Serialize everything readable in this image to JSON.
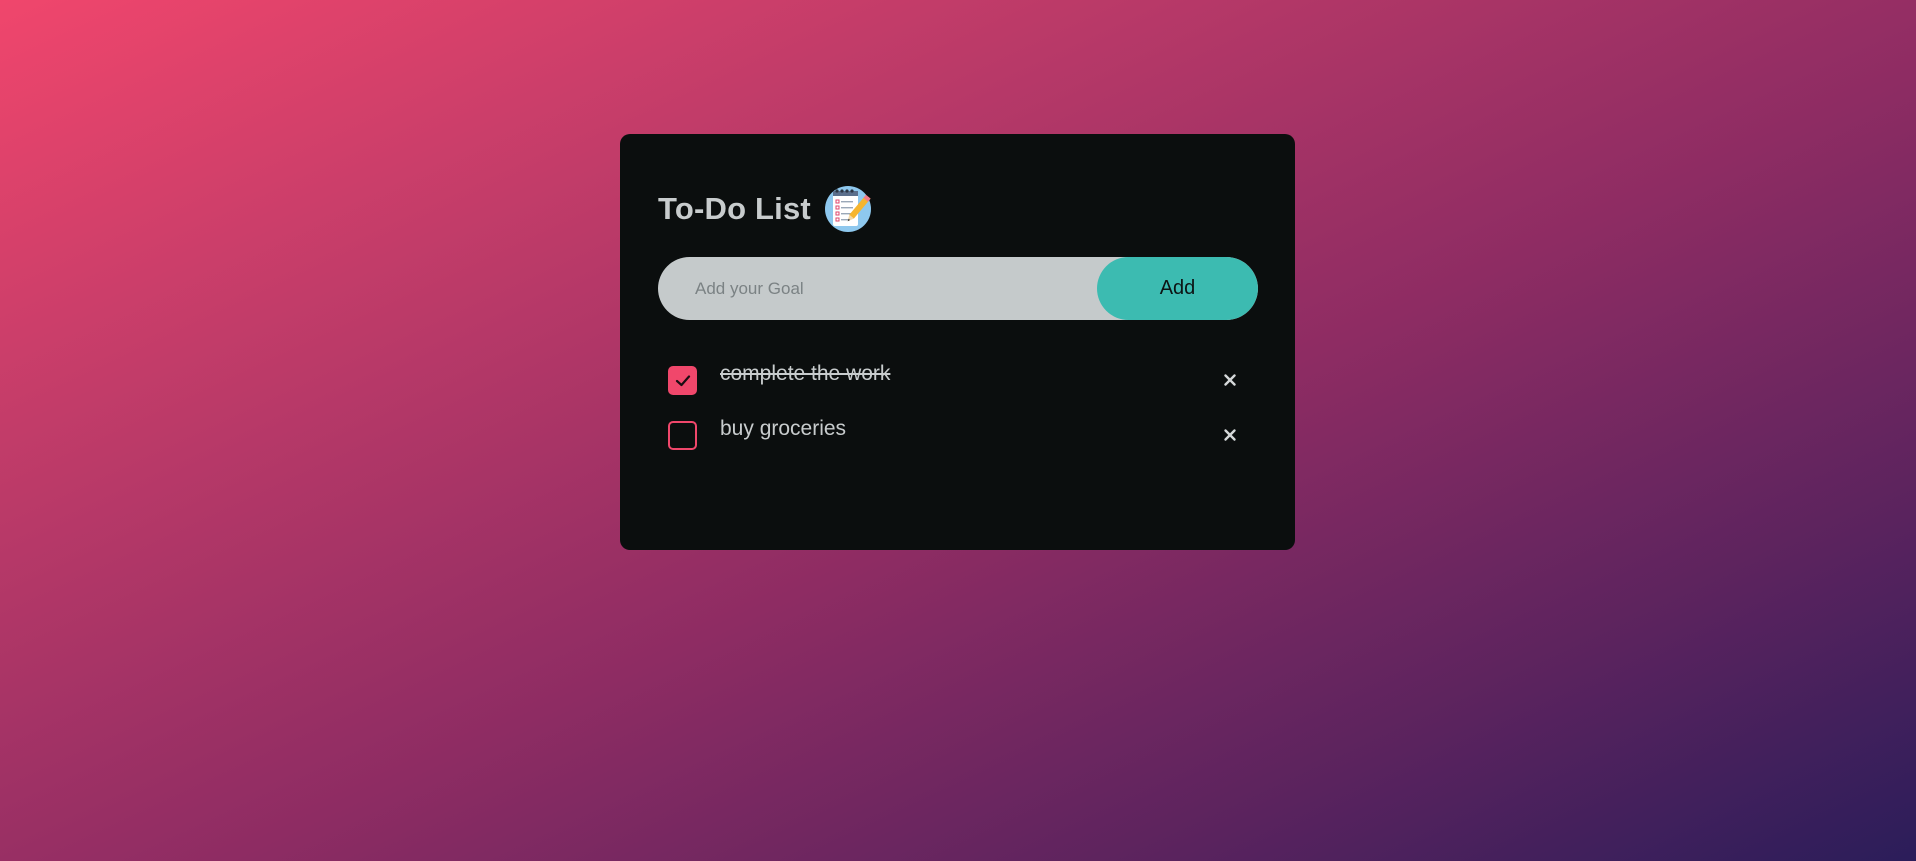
{
  "header": {
    "title": "To-Do List",
    "title_icon": "notepad-icon"
  },
  "input": {
    "placeholder": "Add your Goal",
    "value": "",
    "add_label": "Add"
  },
  "tasks": [
    {
      "text": "complete the work",
      "checked": true,
      "delete_icon": "close-icon"
    },
    {
      "text": "buy groceries",
      "checked": false,
      "delete_icon": "close-icon"
    }
  ],
  "colors": {
    "accent": "#f0476b",
    "add_button": "#3cbbb1",
    "card_background": "#0b0e0e",
    "text": "#c8cccd"
  }
}
